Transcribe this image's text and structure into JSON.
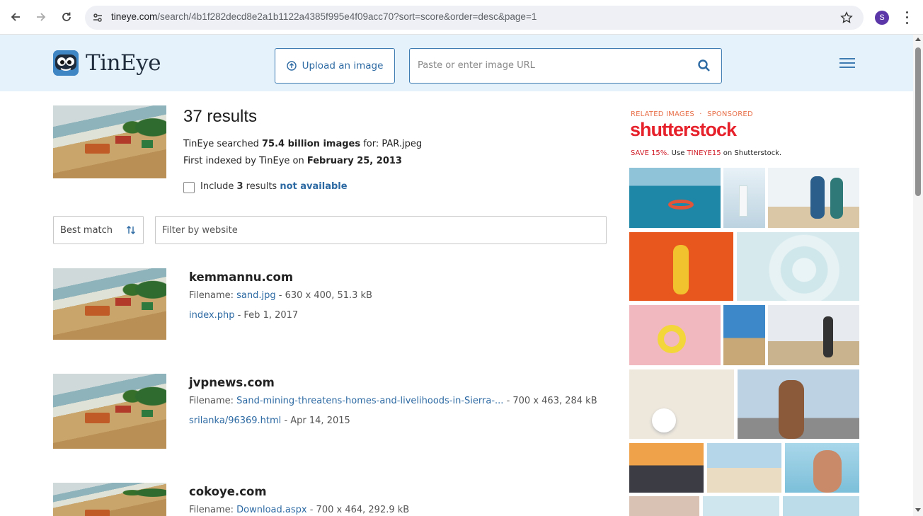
{
  "browser": {
    "url_host": "tineye.com",
    "url_path": "/search/4b1f282decd8e2a1b1122a4385f995e4f09acc70?sort=score&order=desc&page=1",
    "profile_initial": "S"
  },
  "header": {
    "logo_text": "TinEye",
    "upload_label": "Upload an image",
    "url_placeholder": "Paste or enter image URL"
  },
  "summary": {
    "title": "37 results",
    "searched_prefix": "TinEye searched",
    "searched_count": "75.4 billion images",
    "searched_suffix": "for: PAR.jpeg",
    "indexed_prefix": "First indexed by TinEye on",
    "indexed_date": "February 25, 2013",
    "include_prefix": "Include",
    "include_count": "3",
    "include_middle": "results",
    "include_link": "not available"
  },
  "controls": {
    "sort_value": "Best match",
    "filter_placeholder": "Filter by website"
  },
  "results": [
    {
      "domain": "kemmannu.com",
      "filename_label": "Filename:",
      "filename": "sand.jpg",
      "filename_meta": "- 630 x 400, 51.3 kB",
      "page": "index.php",
      "page_meta": "- Feb 1, 2017"
    },
    {
      "domain": "jvpnews.com",
      "filename_label": "Filename:",
      "filename": "Sand-mining-threatens-homes-and-livelihoods-in-Sierra-...",
      "filename_meta": " - 700 x 463, 284 kB",
      "page": "srilanka/96369.html",
      "page_meta": "- Apr 14, 2015"
    },
    {
      "domain": "cokoye.com",
      "filename_label": "Filename:",
      "filename": "Download.aspx",
      "filename_meta": "- 700 x 464, 292.9 kB"
    }
  ],
  "sidebar": {
    "label_related": "RELATED IMAGES",
    "label_sep": "·",
    "label_sponsored": "SPONSORED",
    "brand": "shutterstock",
    "promo_prefix": "SAVE 15%.",
    "promo_use": "Use",
    "promo_code": "TINEYE15",
    "promo_suffix": "on Shutterstock."
  },
  "colors": {
    "accent": "#2d6aa3",
    "header_bg": "#e5f1fb",
    "shutterstock_red": "#e7212b"
  }
}
